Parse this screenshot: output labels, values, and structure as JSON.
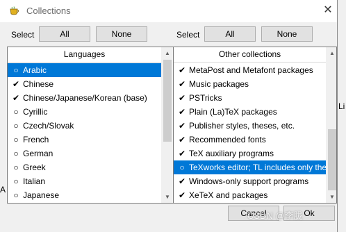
{
  "window": {
    "title": "Collections",
    "icon": "teacup-app-icon",
    "close_glyph": "✕"
  },
  "background": {
    "right_text": "Li",
    "left_text": "A"
  },
  "left": {
    "select_label": "Select",
    "all_button": "All",
    "none_button": "None",
    "list_header": "Languages",
    "items": [
      {
        "mark": "○",
        "label": "Arabic",
        "selected": true,
        "checked": false
      },
      {
        "mark": "✔",
        "label": "Chinese",
        "selected": false,
        "checked": true
      },
      {
        "mark": "✔",
        "label": "Chinese/Japanese/Korean (base)",
        "selected": false,
        "checked": true
      },
      {
        "mark": "○",
        "label": "Cyrillic",
        "selected": false,
        "checked": false
      },
      {
        "mark": "○",
        "label": "Czech/Slovak",
        "selected": false,
        "checked": false
      },
      {
        "mark": "○",
        "label": "French",
        "selected": false,
        "checked": false
      },
      {
        "mark": "○",
        "label": "German",
        "selected": false,
        "checked": false
      },
      {
        "mark": "○",
        "label": "Greek",
        "selected": false,
        "checked": false
      },
      {
        "mark": "○",
        "label": "Italian",
        "selected": false,
        "checked": false
      },
      {
        "mark": "○",
        "label": "Japanese",
        "selected": false,
        "checked": false
      }
    ]
  },
  "right": {
    "select_label": "Select",
    "all_button": "All",
    "none_button": "None",
    "list_header": "Other collections",
    "items": [
      {
        "mark": "✔",
        "label": "MetaPost and Metafont packages",
        "selected": false,
        "checked": true
      },
      {
        "mark": "✔",
        "label": "Music packages",
        "selected": false,
        "checked": true
      },
      {
        "mark": "✔",
        "label": "PSTricks",
        "selected": false,
        "checked": true
      },
      {
        "mark": "✔",
        "label": "Plain (La)TeX packages",
        "selected": false,
        "checked": true
      },
      {
        "mark": "✔",
        "label": "Publisher styles, theses, etc.",
        "selected": false,
        "checked": true
      },
      {
        "mark": "✔",
        "label": "Recommended fonts",
        "selected": false,
        "checked": true
      },
      {
        "mark": "✔",
        "label": "TeX auxiliary programs",
        "selected": false,
        "checked": true
      },
      {
        "mark": "○",
        "label": "TeXworks editor; TL includes only the",
        "selected": true,
        "checked": false
      },
      {
        "mark": "✔",
        "label": "Windows-only support programs",
        "selected": false,
        "checked": true
      },
      {
        "mark": "✔",
        "label": "XeTeX and packages",
        "selected": false,
        "checked": true
      }
    ]
  },
  "footer": {
    "cancel_button": "Cancel",
    "ok_button": "Ok"
  },
  "watermark": "CSDN @李胧",
  "colors": {
    "selection": "#0078d7",
    "button_face": "#e1e1e1",
    "dialog_bg": "#f0f0f0"
  }
}
